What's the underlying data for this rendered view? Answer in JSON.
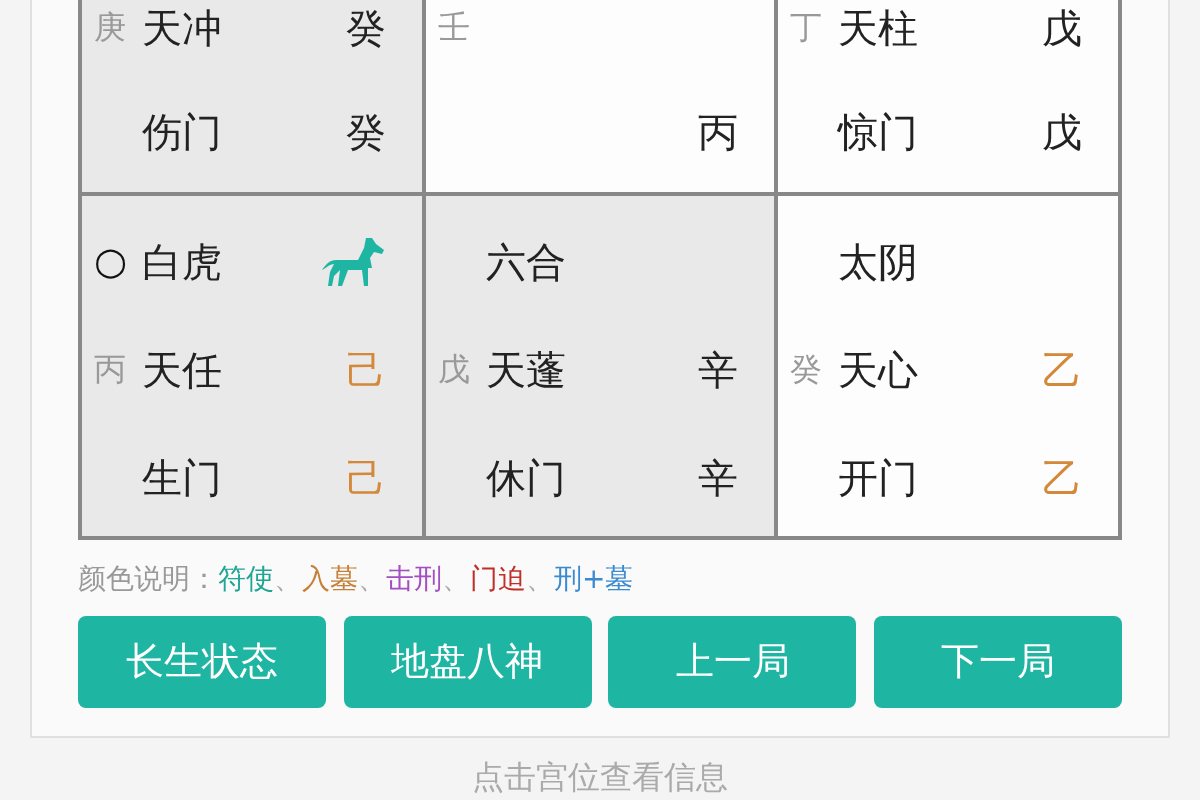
{
  "grid": {
    "rows": [
      {
        "cells": [
          {
            "shaded": true,
            "lines": [
              {
                "prefix": "庚",
                "main": "天冲",
                "right": "癸"
              },
              {
                "main": "伤门",
                "right": "癸"
              }
            ]
          },
          {
            "shaded": false,
            "lines": [
              {
                "prefix": "壬"
              },
              {
                "right": "丙"
              }
            ]
          },
          {
            "shaded": false,
            "lines": [
              {
                "prefix": "丁",
                "main": "天柱",
                "right": "戊"
              },
              {
                "main": "惊门",
                "right": "戊"
              }
            ]
          }
        ]
      },
      {
        "cells": [
          {
            "shaded": true,
            "lines": [
              {
                "prefix": "○",
                "prefix_dark": true,
                "main": "白虎",
                "horse": true
              },
              {
                "prefix": "丙",
                "main": "天任",
                "right": "己",
                "color": "#d4883a"
              },
              {
                "main": "生门",
                "right": "己",
                "color": "#d4883a"
              }
            ]
          },
          {
            "shaded": true,
            "lines": [
              {
                "main": "六合"
              },
              {
                "prefix": "戊",
                "main": "天蓬",
                "right": "辛"
              },
              {
                "main": "休门",
                "right": "辛"
              }
            ]
          },
          {
            "shaded": false,
            "lines": [
              {
                "main": "太阴"
              },
              {
                "prefix": "癸",
                "main": "天心",
                "right": "乙",
                "color": "#d4883a"
              },
              {
                "main": "开门",
                "right": "乙",
                "color": "#d4883a"
              }
            ]
          }
        ]
      }
    ]
  },
  "legend": {
    "label": "颜色说明：",
    "separator": "、",
    "items": [
      {
        "text": "符使",
        "color": "#1fa593"
      },
      {
        "text": "入墓",
        "color": "#c7803a"
      },
      {
        "text": "击刑",
        "color": "#a34fc0"
      },
      {
        "text": "门迫",
        "color": "#c0302a"
      },
      {
        "text": "刑+墓",
        "color": "#3a8ad0"
      }
    ]
  },
  "buttons": [
    "长生状态",
    "地盘八神",
    "上一局",
    "下一局"
  ],
  "hint": "点击宫位查看信息"
}
